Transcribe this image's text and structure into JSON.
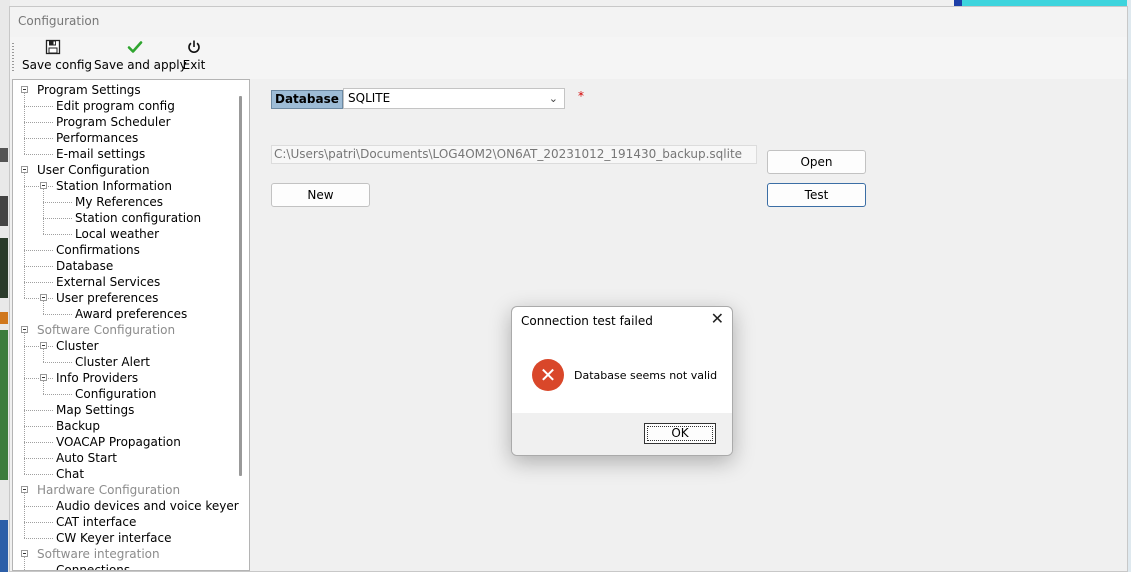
{
  "window": {
    "title": "Configuration"
  },
  "toolbar": {
    "save_config": "Save config",
    "save_and_apply": "Save and apply",
    "exit": "Exit"
  },
  "tree": {
    "items": [
      {
        "label": "Program Settings",
        "depth": 0,
        "expander": true,
        "disabled": false
      },
      {
        "label": "Edit program config",
        "depth": 1,
        "expander": false,
        "disabled": false
      },
      {
        "label": "Program Scheduler",
        "depth": 1,
        "expander": false,
        "disabled": false
      },
      {
        "label": "Performances",
        "depth": 1,
        "expander": false,
        "disabled": false
      },
      {
        "label": "E-mail settings",
        "depth": 1,
        "expander": false,
        "disabled": false
      },
      {
        "label": "User Configuration",
        "depth": 0,
        "expander": true,
        "disabled": false
      },
      {
        "label": "Station Information",
        "depth": 1,
        "expander": true,
        "disabled": false
      },
      {
        "label": "My References",
        "depth": 2,
        "expander": false,
        "disabled": false
      },
      {
        "label": "Station configuration",
        "depth": 2,
        "expander": false,
        "disabled": false
      },
      {
        "label": "Local weather",
        "depth": 2,
        "expander": false,
        "disabled": false
      },
      {
        "label": "Confirmations",
        "depth": 1,
        "expander": false,
        "disabled": false
      },
      {
        "label": "Database",
        "depth": 1,
        "expander": false,
        "disabled": false,
        "selected": true
      },
      {
        "label": "External Services",
        "depth": 1,
        "expander": false,
        "disabled": false
      },
      {
        "label": "User preferences",
        "depth": 1,
        "expander": true,
        "disabled": false
      },
      {
        "label": "Award preferences",
        "depth": 2,
        "expander": false,
        "disabled": false
      },
      {
        "label": "Software Configuration",
        "depth": 0,
        "expander": true,
        "disabled": true
      },
      {
        "label": "Cluster",
        "depth": 1,
        "expander": true,
        "disabled": false
      },
      {
        "label": "Cluster Alert",
        "depth": 2,
        "expander": false,
        "disabled": false
      },
      {
        "label": "Info Providers",
        "depth": 1,
        "expander": true,
        "disabled": false
      },
      {
        "label": "Configuration",
        "depth": 2,
        "expander": false,
        "disabled": false
      },
      {
        "label": "Map Settings",
        "depth": 1,
        "expander": false,
        "disabled": false
      },
      {
        "label": "Backup",
        "depth": 1,
        "expander": false,
        "disabled": false
      },
      {
        "label": "VOACAP Propagation",
        "depth": 1,
        "expander": false,
        "disabled": false
      },
      {
        "label": "Auto Start",
        "depth": 1,
        "expander": false,
        "disabled": false
      },
      {
        "label": "Chat",
        "depth": 1,
        "expander": false,
        "disabled": false
      },
      {
        "label": "Hardware Configuration",
        "depth": 0,
        "expander": true,
        "disabled": true
      },
      {
        "label": "Audio devices and voice keyer",
        "depth": 1,
        "expander": false,
        "disabled": false
      },
      {
        "label": "CAT interface",
        "depth": 1,
        "expander": false,
        "disabled": false
      },
      {
        "label": "CW Keyer interface",
        "depth": 1,
        "expander": false,
        "disabled": false
      },
      {
        "label": "Software integration",
        "depth": 0,
        "expander": true,
        "disabled": true
      },
      {
        "label": "Connections",
        "depth": 1,
        "expander": false,
        "disabled": false
      }
    ]
  },
  "database": {
    "label": "Database",
    "type_value": "SQLITE",
    "required_marker": "*",
    "path": "C:\\Users\\patri\\Documents\\LOG4OM2\\ON6AT_20231012_191430_backup.sqlite",
    "open_label": "Open",
    "new_label": "New",
    "test_label": "Test"
  },
  "dialog": {
    "title": "Connection test failed",
    "message": "Database seems not valid",
    "ok_label": "OK"
  },
  "colors": {
    "accent": "#3b6ea5",
    "label_highlight": "#9dbcd6",
    "error_icon": "#d9472a",
    "required": "#d40000"
  }
}
